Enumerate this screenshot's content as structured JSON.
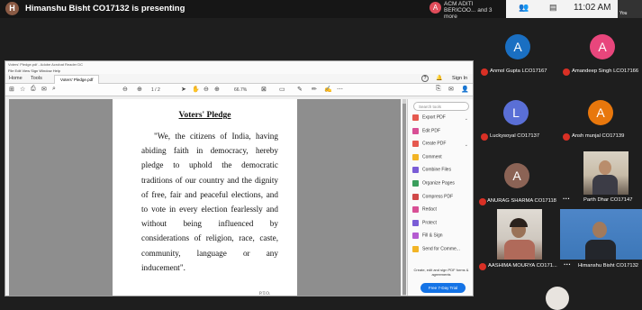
{
  "meeting": {
    "presenter_initial": "H",
    "presenter_text": "Himanshu Bisht CO17132 is presenting",
    "top_participant_initial": "A",
    "top_participant_name": "ACM ADITI BERICOO... and 3 more",
    "clock": "11:02 AM",
    "mini_tile_label": "You"
  },
  "reader": {
    "title_bar": "Voters' Pledge.pdf - Adobe Acrobat Reader DC",
    "menu": "File  Edit  View  Sign  Window  Help",
    "tabs": [
      "Home",
      "Tools"
    ],
    "file_tab": "Voters' Pledge.pdf",
    "sign_in": "Sign In",
    "page_indicator": "1 / 2",
    "zoom": "66.7%",
    "search_placeholder": "Search tools",
    "tools": [
      {
        "label": "Export PDF",
        "color": "#e5594f",
        "chevron": "⌄"
      },
      {
        "label": "Edit PDF",
        "color": "#d84f95",
        "chevron": ""
      },
      {
        "label": "Create PDF",
        "color": "#e5594f",
        "chevron": "⌄"
      },
      {
        "label": "Comment",
        "color": "#f2b425",
        "chevron": ""
      },
      {
        "label": "Combine Files",
        "color": "#7a5cd6",
        "chevron": ""
      },
      {
        "label": "Organize Pages",
        "color": "#3a9e5c",
        "chevron": ""
      },
      {
        "label": "Compress PDF",
        "color": "#d04848",
        "chevron": ""
      },
      {
        "label": "Redact",
        "color": "#d84f95",
        "chevron": ""
      },
      {
        "label": "Protect",
        "color": "#7a5cd6",
        "chevron": ""
      },
      {
        "label": "Fill & Sign",
        "color": "#b55bd1",
        "chevron": ""
      },
      {
        "label": "Send for Comme...",
        "color": "#f2b425",
        "chevron": ""
      }
    ],
    "promo_text": "Create, edit and sign PDF forms & agreements",
    "trial_button": "Free 7-Day Trial"
  },
  "document": {
    "title": "Voters' Pledge",
    "body": "\"We, the citizens of India, having abiding faith in democracy, hereby pledge to uphold the democratic traditions of our country and the dignity of free, fair and peaceful elections, and to vote in every election fearlessly and without being influenced by considerations of religion, race, caste, community, language or any inducement\".",
    "page_footer": "P.T.O."
  },
  "participants": {
    "p1": {
      "initial": "A",
      "name": "Anmol Gupta LCO17167",
      "color": "#1a6fc2"
    },
    "p2": {
      "initial": "A",
      "name": "Amandeep Singh LCO17166",
      "color": "#e8467c"
    },
    "p3": {
      "initial": "L",
      "name": "Luckysoyal CO17137",
      "color": "#5a6fd6"
    },
    "p4": {
      "initial": "A",
      "name": "Ansh munjal CO17139",
      "color": "#e8770c"
    },
    "p5": {
      "initial": "A",
      "name": "ANURAG SHARMA CO17118",
      "color": "#8b6355"
    },
    "p6": {
      "name": "Parth Dhar CO17147"
    },
    "p7": {
      "name": "AASHIMA MOURYA CO171..."
    },
    "p8": {
      "name": "Himanshu Bisht CO17132"
    }
  }
}
